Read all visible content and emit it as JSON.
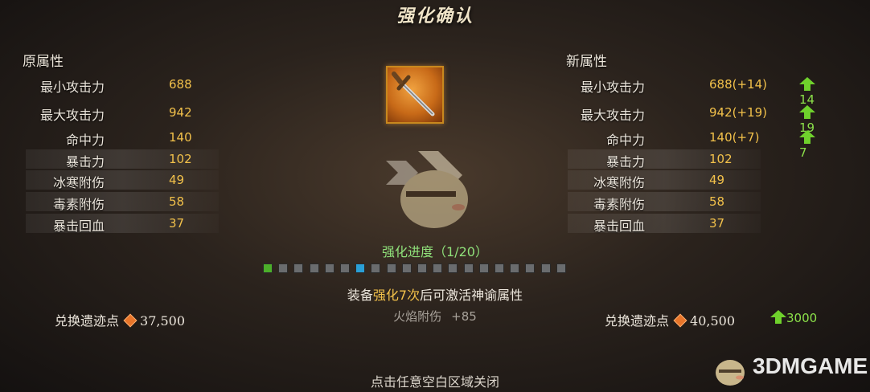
{
  "title": "强化确认",
  "left_panel": {
    "heading": "原属性",
    "stats": [
      {
        "label": "最小攻击力",
        "value": "688"
      },
      {
        "label": "最大攻击力",
        "value": "942"
      },
      {
        "label": "命中力",
        "value": "140"
      },
      {
        "label": "暴击力",
        "value": "102"
      },
      {
        "label": "冰寒附伤",
        "value": "49"
      },
      {
        "label": "毒素附伤",
        "value": "58"
      },
      {
        "label": "暴击回血",
        "value": "37"
      }
    ],
    "exchange_label": "兑换遗迹点",
    "exchange_value": "37,500"
  },
  "right_panel": {
    "heading": "新属性",
    "stats": [
      {
        "label": "最小攻击力",
        "value": "688(+14)",
        "increase": "14"
      },
      {
        "label": "最大攻击力",
        "value": "942(+19)",
        "increase": "19"
      },
      {
        "label": "命中力",
        "value": "140(+7)",
        "increase": "7"
      },
      {
        "label": "暴击力",
        "value": "102"
      },
      {
        "label": "冰寒附伤",
        "value": "49"
      },
      {
        "label": "毒素附伤",
        "value": "58"
      },
      {
        "label": "暴击回血",
        "value": "37"
      }
    ],
    "exchange_label": "兑换遗迹点",
    "exchange_value": "40,500",
    "exchange_increase": "3000"
  },
  "item_icon": "sword-icon",
  "progress": {
    "text": "强化进度（1/20）",
    "current": 1,
    "total": 20,
    "highlight_index": 6
  },
  "info": {
    "prefix": "装备",
    "highlight": "强化7次",
    "suffix": "后可激活神谕属性"
  },
  "fire_bonus": {
    "label": "火焰附伤",
    "value": "+85"
  },
  "close_hint": "点击任意空白区域关闭",
  "watermark": "3DMGAME",
  "colors": {
    "gold": "#f2c14a",
    "green": "#8be04a",
    "progress_done": "#4caf2a",
    "progress_marker": "#2a9fd6",
    "progress_empty": "#6a6c6e"
  }
}
